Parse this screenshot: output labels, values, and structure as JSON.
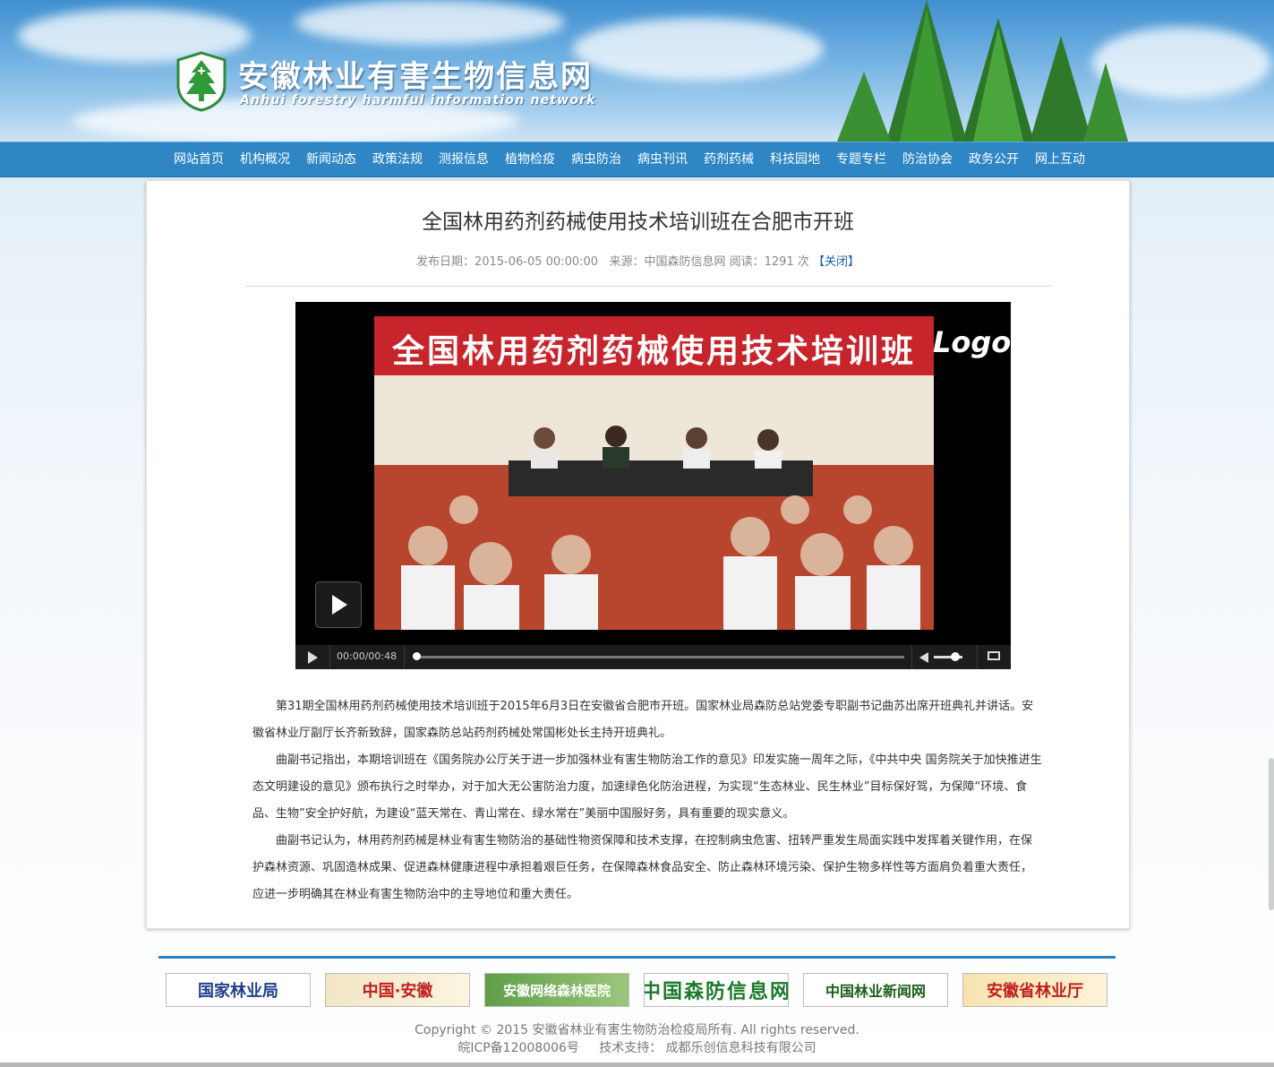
{
  "header": {
    "title": "安徽林业有害生物信息网",
    "subtitle": "Anhui forestry harmful information network"
  },
  "nav": {
    "items": [
      "网站首页",
      "机构概况",
      "新闻动态",
      "政策法规",
      "测报信息",
      "植物检疫",
      "病虫防治",
      "病虫刊讯",
      "药剂药械",
      "科技园地",
      "专题专栏",
      "防治协会",
      "政务公开",
      "网上互动"
    ]
  },
  "article": {
    "title": "全国林用药剂药械使用技术培训班在合肥市开班",
    "meta": {
      "date_label": "发布日期：",
      "date": "2015-06-05 00:00:00",
      "source_label": "来源：",
      "source": "中国森防信息网",
      "reads_label": "阅读：",
      "reads": "1291",
      "reads_unit": "次",
      "close_link": "【关闭】"
    },
    "paragraphs": [
      "第31期全国林用药剂药械使用技术培训班于2015年6月3日在安徽省合肥市开班。国家林业局森防总站党委专职副书记曲苏出席开班典礼并讲话。安徽省林业厅副厅长齐新致辞，国家森防总站药剂药械处常国彬处长主持开班典礼。",
      "曲副书记指出，本期培训班在《国务院办公厅关于进一步加强林业有害生物防治工作的意见》印发实施一周年之际，《中共中央 国务院关于加快推进生态文明建设的意见》颁布执行之时举办，对于加大无公害防治力度，加速绿色化防治进程，为实现“生态林业、民生林业”目标保好驾，为保障“环境、食品、生物”安全护好航，为建设“蓝天常在、青山常在、绿水常在”美丽中国服好务，具有重要的现实意义。",
      "曲副书记认为，林用药剂药械是林业有害生物防治的基础性物资保障和技术支撑，在控制病虫危害、扭转严重发生局面实践中发挥着关键作用，在保护森林资源、巩固造林成果、促进森林健康进程中承担着艰巨任务，在保障森林食品安全、防止森林环境污染、保护生物多样性等方面肩负着重大责任，应进一步明确其在林业有害生物防治中的主导地位和重大责任。"
    ]
  },
  "video": {
    "banner_text": "全国林用药剂药械使用技术培训班",
    "watermark": "Logo",
    "time": "00:00/00:48",
    "progress_fraction": 0.0,
    "volume_fraction": 0.8
  },
  "footer": {
    "links": [
      "国家林业局",
      "中国·安徽",
      "安徽网络森林医院",
      "中国森防信息网",
      "中国林业新闻网",
      "安徽省林业厅"
    ],
    "copyright": "Copyright © 2015 安徽省林业有害生物防治检疫局所有. All rights reserved.",
    "icp": "皖ICP备12008006号",
    "support_label": "技术支持：",
    "support": "成都乐创信息科技有限公司"
  },
  "colors": {
    "nav_bg": "#2e86c4",
    "banner_red": "#c8242b",
    "link_blue": "#1a5fa8",
    "footer_line": "#2e7fbf"
  },
  "icons": [
    "shield-tree-logo-icon",
    "play-icon",
    "volume-icon",
    "fullscreen-icon"
  ]
}
